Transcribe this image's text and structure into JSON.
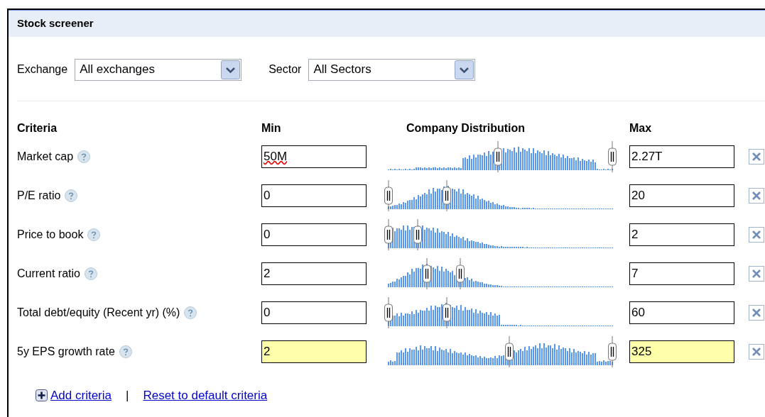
{
  "panel": {
    "title": "Stock screener"
  },
  "filters": [
    {
      "label": "Exchange",
      "value": "All exchanges"
    },
    {
      "label": "Sector",
      "value": "All Sectors"
    }
  ],
  "table": {
    "columns": [
      "Criteria",
      "Min",
      "Company Distribution",
      "Max"
    ],
    "rows": [
      {
        "name": "Market cap",
        "min": "50M",
        "misspelled": true,
        "max": "2.27T",
        "highlighted": false,
        "handles": [
          {
            "level": 0.49
          },
          {
            "level": 1.0
          }
        ]
      },
      {
        "name": "P/E ratio",
        "min": "0",
        "misspelled": false,
        "max": "20",
        "highlighted": false,
        "handles": [
          {
            "level": 0.0
          },
          {
            "level": 0.26
          }
        ]
      },
      {
        "name": "Price to book",
        "min": "0",
        "misspelled": false,
        "max": "2",
        "highlighted": false,
        "handles": [
          {
            "level": 0.0
          },
          {
            "level": 0.13
          }
        ]
      },
      {
        "name": "Current ratio",
        "min": "2",
        "misspelled": false,
        "max": "7",
        "highlighted": false,
        "handles": [
          {
            "level": 0.17
          },
          {
            "level": 0.32
          }
        ]
      },
      {
        "name": "Total debt/equity (Recent yr) (%)",
        "min": "0",
        "misspelled": false,
        "max": "60",
        "highlighted": false,
        "handles": [
          {
            "level": 0.0
          },
          {
            "level": 0.26
          }
        ]
      },
      {
        "name": "5y EPS growth rate",
        "min": "2",
        "misspelled": false,
        "max": "325",
        "highlighted": true,
        "handles": [
          {
            "level": 0.54
          },
          {
            "level": 1.0
          }
        ]
      }
    ]
  },
  "links": {
    "add": "Add criteria",
    "separator": "|",
    "reset": "Reset to default criteria"
  }
}
